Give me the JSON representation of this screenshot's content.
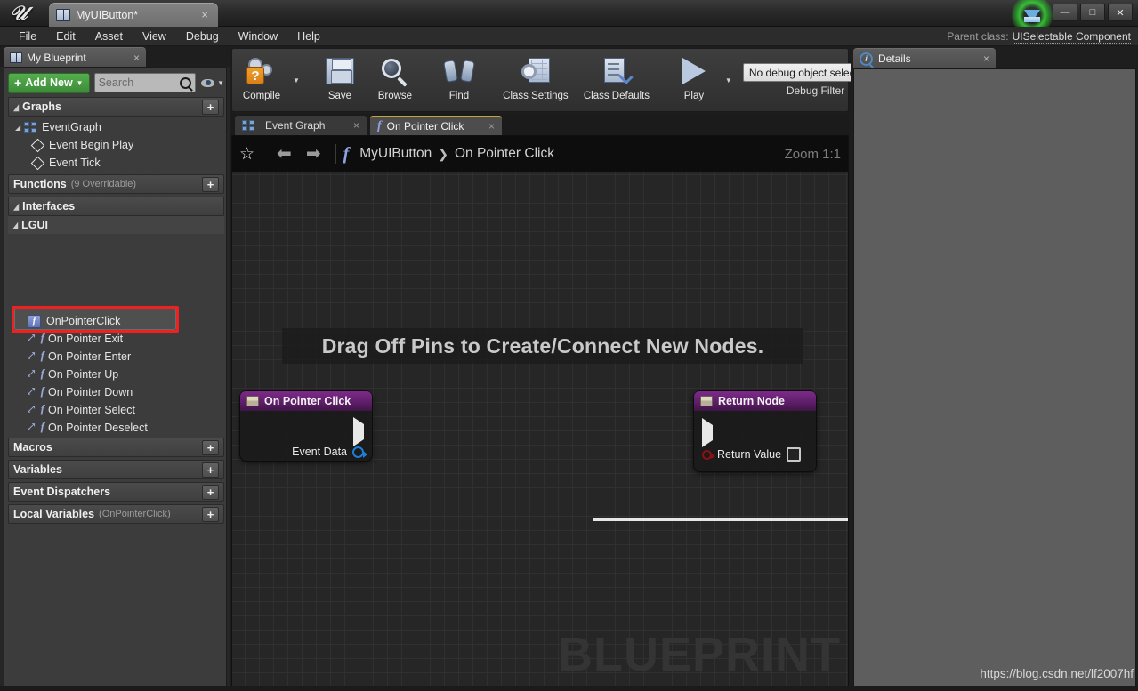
{
  "titlebar": {
    "logo_icon": "unreal-logo-icon",
    "document_tab": {
      "title": "MyUIButton*",
      "close": "×",
      "icon": "blueprint-book-icon"
    },
    "window_buttons": {
      "minimize": "—",
      "maximize": "□",
      "close": "✕"
    },
    "badge_icon": "ue-gem-icon"
  },
  "menubar": {
    "items": [
      "File",
      "Edit",
      "Asset",
      "View",
      "Debug",
      "Window",
      "Help"
    ],
    "parent_class_label": "Parent class:",
    "parent_class_value": "UISelectable Component"
  },
  "my_blueprint": {
    "tab_title": "My Blueprint",
    "tab_close": "×",
    "add_new_label": "Add New",
    "add_new_plus": "+",
    "add_new_caret": "▼",
    "search_placeholder": "Search",
    "search_value": "",
    "eye_caret": "▼",
    "sections": {
      "graphs": {
        "label": "Graphs",
        "add": "+",
        "tri": "◢"
      },
      "functions": {
        "label": "Functions",
        "sub": "(9 Overridable)",
        "add": "+"
      },
      "interfaces": {
        "label": "Interfaces",
        "add": "",
        "tri": "◢"
      },
      "macros": {
        "label": "Macros",
        "add": "+"
      },
      "variables": {
        "label": "Variables",
        "add": "+"
      },
      "event_dispatchers": {
        "label": "Event Dispatchers",
        "add": "+"
      },
      "local_variables": {
        "label": "Local Variables",
        "sub": "(OnPointerClick)",
        "add": "+"
      }
    },
    "event_graph": {
      "label": "EventGraph",
      "tri": "◢",
      "icon": "event-graph-icon"
    },
    "graph_events": [
      {
        "label": "Event Begin Play",
        "icon": "event-node-icon"
      },
      {
        "label": "Event Tick",
        "icon": "event-node-icon"
      }
    ],
    "interface_group": {
      "label": "LGUI",
      "tri": "◢"
    },
    "interface_functions": [
      {
        "label": "OnPointerClick",
        "icon": "function-icon",
        "selected": true,
        "highlighted": true
      },
      {
        "label": "On Pointer Exit",
        "icon": "event-function-icon",
        "selected": false
      },
      {
        "label": "On Pointer Enter",
        "icon": "event-function-icon",
        "selected": false
      },
      {
        "label": "On Pointer Up",
        "icon": "event-function-icon",
        "selected": false
      },
      {
        "label": "On Pointer Down",
        "icon": "event-function-icon",
        "selected": false
      },
      {
        "label": "On Pointer Select",
        "icon": "event-function-icon",
        "selected": false
      },
      {
        "label": "On Pointer Deselect",
        "icon": "event-function-icon",
        "selected": false
      }
    ],
    "highlight_color": "#f02020"
  },
  "toolbar": {
    "buttons": [
      {
        "label": "Compile",
        "icon": "compile-gear-question-icon",
        "has_caret": true
      },
      {
        "label": "Save",
        "icon": "save-floppy-icon",
        "has_caret": false
      },
      {
        "label": "Browse",
        "icon": "browse-magnifier-icon",
        "has_caret": false
      },
      {
        "label": "Find",
        "icon": "find-binoculars-icon",
        "has_caret": false
      },
      {
        "label": "Class Settings",
        "icon": "class-settings-icon",
        "has_caret": false
      },
      {
        "label": "Class Defaults",
        "icon": "class-defaults-icon",
        "has_caret": false
      },
      {
        "label": "Play",
        "icon": "play-triangle-icon",
        "has_caret": true
      }
    ],
    "caret": "▼",
    "debug": {
      "selected": "No debug object selected",
      "caret": "▼",
      "filter_label": "Debug Filter"
    }
  },
  "graph_tabs": [
    {
      "label": "Event Graph",
      "icon": "event-graph-icon",
      "close": "×",
      "active": false
    },
    {
      "label": "On Pointer Click",
      "icon": "function-icon",
      "close": "×",
      "active": true
    }
  ],
  "graph": {
    "star_icon": "☆",
    "back_icon": "⬅",
    "forward_icon": "➡",
    "breadcrumb_fn_icon": "f",
    "breadcrumb_root": "MyUIButton",
    "breadcrumb_separator": "❯",
    "breadcrumb_leaf": "On Pointer Click",
    "zoom_label": "Zoom 1:1",
    "hint_banner": "Drag Off Pins to Create/Connect New Nodes.",
    "watermark": "BLUEPRINT",
    "nodes": [
      {
        "title": "On Pointer Click",
        "icon": "event-node-icon",
        "header_color": "#5e1f69",
        "pins": [
          {
            "name": "",
            "type": "exec",
            "side": "output"
          },
          {
            "name": "Event Data",
            "type": "object",
            "side": "output"
          }
        ]
      },
      {
        "title": "Return Node",
        "icon": "event-node-icon",
        "header_color": "#5e1f69",
        "pins": [
          {
            "name": "",
            "type": "exec",
            "side": "input"
          },
          {
            "name": "Return Value",
            "type": "bool",
            "side": "input",
            "value": false
          }
        ]
      }
    ]
  },
  "details": {
    "tab_title": "Details",
    "tab_close": "×",
    "icon": "details-info-icon"
  },
  "watermark_url": "https://blog.csdn.net/lf2007hf"
}
